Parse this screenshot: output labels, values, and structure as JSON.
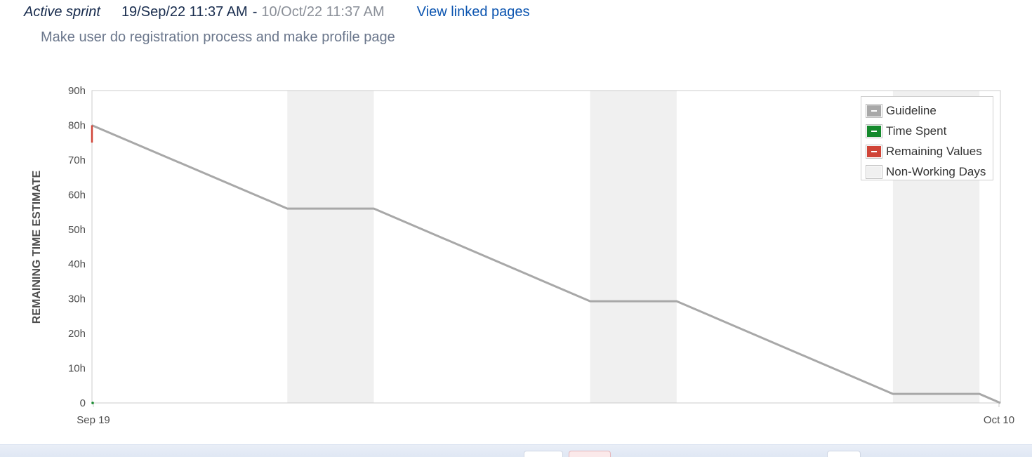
{
  "sprint": {
    "status": "Active sprint",
    "start": "19/Sep/22 11:37 AM",
    "separator": "-",
    "end": "10/Oct/22 11:37 AM",
    "linked_pages": "View linked pages",
    "goal": "Make user do registration process and make profile page"
  },
  "colors": {
    "guideline": "#a8a8a8",
    "time_spent": "#14892c",
    "remaining": "#d04437",
    "non_working": "#f0f0f0"
  },
  "legend": {
    "items": [
      {
        "label": "Guideline",
        "color": "#a8a8a8"
      },
      {
        "label": "Time Spent",
        "color": "#14892c"
      },
      {
        "label": "Remaining Values",
        "color": "#d04437"
      },
      {
        "label": "Non-Working Days",
        "color": "#f0f0f0"
      }
    ]
  },
  "chart_data": {
    "type": "line",
    "ylabel": "REMAINING TIME ESTIMATE",
    "xlabel": "",
    "x_tick_labels": [
      "Sep 19",
      "Oct 10"
    ],
    "y_tick_labels": [
      "0",
      "10h",
      "20h",
      "30h",
      "40h",
      "50h",
      "60h",
      "70h",
      "80h",
      "90h"
    ],
    "ylim": [
      0,
      90
    ],
    "xlim": [
      "2022-09-19 11:37",
      "2022-10-10 11:37"
    ],
    "grid": false,
    "legend_position": "top-right",
    "non_working_days": [
      [
        "2022-09-24 00:00",
        "2022-09-26 00:00"
      ],
      [
        "2022-10-01 00:00",
        "2022-10-03 00:00"
      ],
      [
        "2022-10-08 00:00",
        "2022-10-10 00:00"
      ]
    ],
    "series": [
      {
        "name": "Guideline",
        "color": "#a8a8a8",
        "x": [
          "2022-09-19 11:37",
          "2022-09-24 00:00",
          "2022-09-26 00:00",
          "2022-10-01 00:00",
          "2022-10-03 00:00",
          "2022-10-08 00:00",
          "2022-10-10 00:00",
          "2022-10-10 11:37"
        ],
        "y": [
          80,
          56,
          56,
          29.3,
          29.3,
          2.6,
          2.6,
          0
        ]
      },
      {
        "name": "Remaining Values",
        "color": "#d04437",
        "x": [
          "2022-09-19 11:37",
          "2022-09-19 11:37"
        ],
        "y": [
          80,
          75
        ]
      },
      {
        "name": "Time Spent",
        "color": "#14892c",
        "x": [
          "2022-09-19 11:37"
        ],
        "y": [
          0
        ]
      }
    ]
  }
}
